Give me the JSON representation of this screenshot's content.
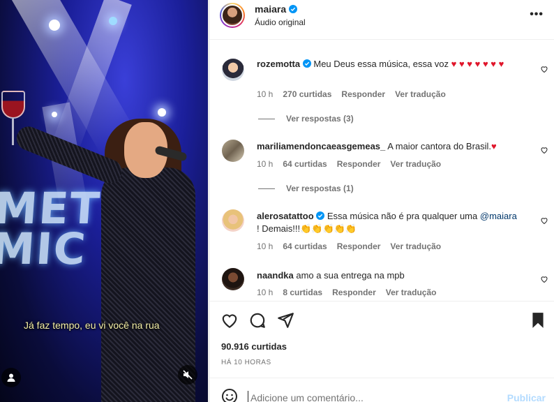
{
  "video": {
    "caption": "Já faz tempo, eu vi você na rua",
    "stage_text": "MEU\nCMO"
  },
  "header": {
    "username": "maiara",
    "subtitle": "Áudio original",
    "more_icon": "more-horizontal-icon"
  },
  "comments": [
    {
      "username": "rozemotta",
      "verified": true,
      "text_parts": [
        "Meu Deus essa música, essa voz "
      ],
      "hearts": "♥ ♥ ♥ ♥ ♥ ♥ ♥",
      "time": "10 h",
      "likes": "270 curtidas",
      "reply": "Responder",
      "translate": "Ver tradução",
      "view_replies": "Ver respostas (3)"
    },
    {
      "username": "mariliamendoncaeasgemeas_",
      "verified": false,
      "text": "A maior cantora do Brasil.",
      "hearts": "♥",
      "time": "10 h",
      "likes": "64 curtidas",
      "reply": "Responder",
      "translate": "Ver tradução",
      "view_replies": "Ver respostas (1)"
    },
    {
      "username": "alerosatattoo",
      "verified": true,
      "text": "Essa música não é pra qualquer uma",
      "mention": "@maiara",
      "text_after": "! Demais!!!",
      "claps": "👏👏👏👏👏",
      "time": "10 h",
      "likes": "64 curtidas",
      "reply": "Responder",
      "translate": "Ver tradução"
    },
    {
      "username": "naandka",
      "verified": false,
      "text": "amo a sua entrega na mpb",
      "time": "10 h",
      "likes": "8 curtidas",
      "reply": "Responder",
      "translate": "Ver tradução"
    }
  ],
  "actions": {
    "like_icon": "heart-icon",
    "comment_icon": "comment-icon",
    "share_icon": "send-icon",
    "save_icon": "bookmark-icon",
    "likes": "90.916 curtidas",
    "time": "HÁ 10 HORAS"
  },
  "composer": {
    "placeholder": "Adicione um comentário...",
    "publish": "Publicar",
    "emoji_icon": "emoji-icon"
  },
  "colors": {
    "verified": "#0095f6",
    "heart_red": "#e0162b",
    "publish_disabled": "#b3dbff",
    "meta_gray": "#737373"
  }
}
